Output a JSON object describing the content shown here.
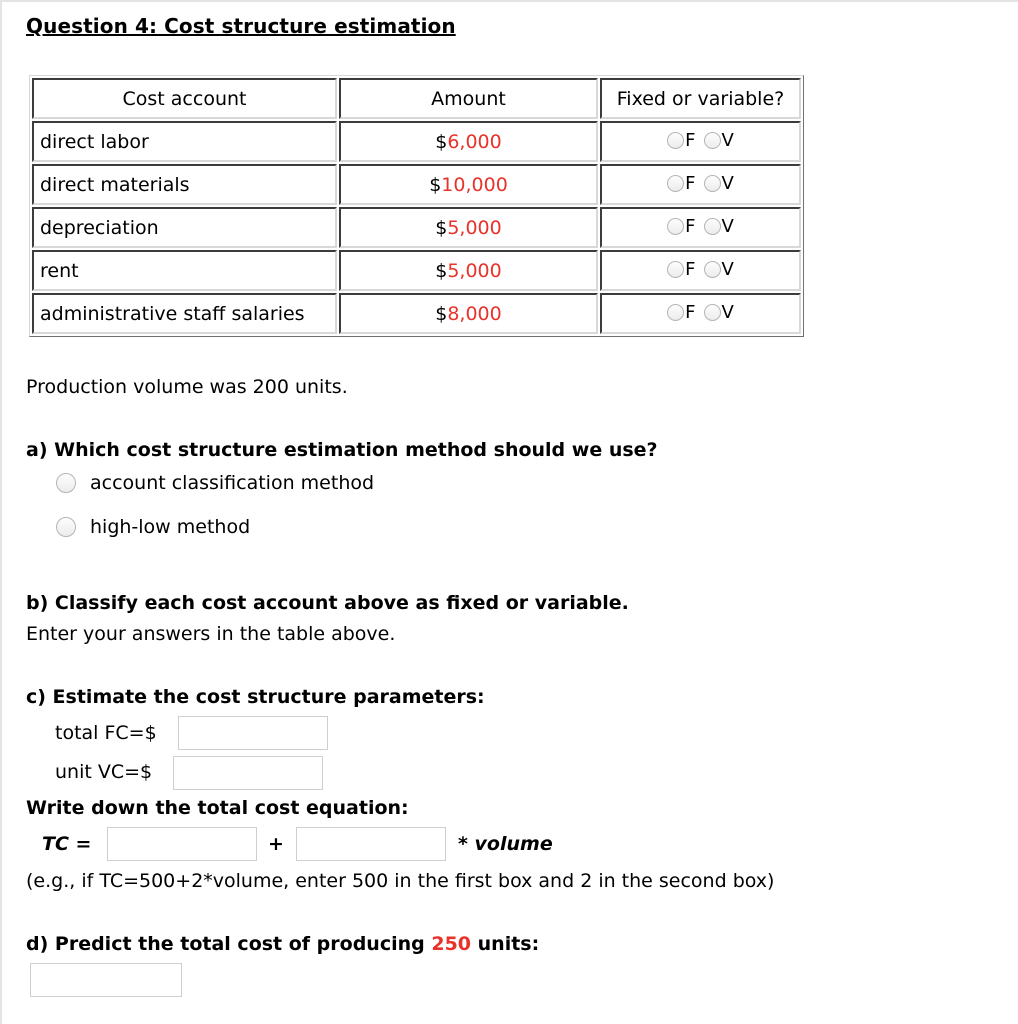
{
  "title": "Question 4: Cost structure estimation",
  "table": {
    "headers": [
      "Cost account",
      "Amount",
      "Fixed or variable?"
    ],
    "rows": [
      {
        "account": "direct labor",
        "currency": "$",
        "amount": "6,000"
      },
      {
        "account": "direct materials",
        "currency": "$",
        "amount": "10,000"
      },
      {
        "account": "depreciation",
        "currency": "$",
        "amount": "5,000"
      },
      {
        "account": "rent",
        "currency": "$",
        "amount": "5,000"
      },
      {
        "account": "administrative staff salaries",
        "currency": "$",
        "amount": "8,000"
      }
    ],
    "option_f": "F",
    "option_v": "V"
  },
  "production_note": "Production volume was 200 units.",
  "part_a": {
    "question": "a) Which cost structure estimation method should we use?",
    "options": [
      "account classification method",
      "high-low method"
    ]
  },
  "part_b": {
    "question": "b) Classify each cost account above as fixed or variable.",
    "instruction": "Enter your answers in the table above."
  },
  "part_c": {
    "question": "c) Estimate the cost structure parameters:",
    "fc_label": "total FC=$",
    "fc_value": "",
    "vc_label": "unit VC=$",
    "vc_value": "",
    "equation_heading": "Write down the total cost equation:",
    "tc_label": "TC =",
    "plus": "+",
    "volume_label": "* volume",
    "tc_fixed_value": "",
    "tc_variable_value": "",
    "example": "(e.g., if TC=500+2*volume, enter 500 in the first box and 2 in the second box)"
  },
  "part_d": {
    "question_prefix": "d) Predict the total cost of producing ",
    "units": "250",
    "question_suffix": " units:",
    "answer_value": ""
  },
  "colors": {
    "highlight": "#e8322a"
  }
}
